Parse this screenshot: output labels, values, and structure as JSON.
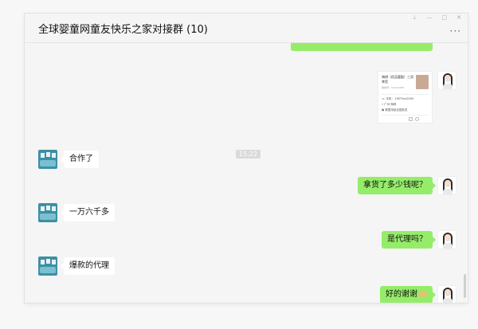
{
  "window": {
    "title": "全球婴童网童友快乐之家对接群 (10)",
    "more_label": "···",
    "controls": [
      "pin-icon",
      "minimize-icon",
      "maximize-icon",
      "close-icon"
    ],
    "control_glyphs": {
      "pin": "⊥",
      "min": "—",
      "max": "□",
      "close": "✕"
    }
  },
  "chat": {
    "card": {
      "name": "海琪（优品婴配）三灵·李哲",
      "sub": "微信号：hai123456",
      "lines": [
        "☏ 手机：13875xx0000",
        "⌖ 广州·海珠",
        "▣ 婴童用品全国批发"
      ]
    },
    "timestamp": "15:22",
    "messages": [
      {
        "side": "left",
        "text": "合作了"
      },
      {
        "side": "right",
        "text": "拿货了多少钱呢？"
      },
      {
        "side": "left",
        "text": "一万六千多"
      },
      {
        "side": "right",
        "text": "是代理吗？"
      },
      {
        "side": "left",
        "text": "爆款的代理"
      },
      {
        "side": "right",
        "text": "好的谢谢"
      }
    ]
  },
  "colors": {
    "bubble_self": "#95ec69",
    "bubble_other": "#ffffff",
    "background": "#f5f5f5"
  }
}
